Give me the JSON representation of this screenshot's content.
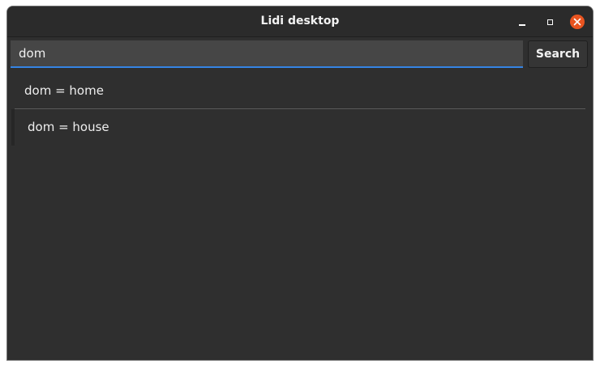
{
  "window": {
    "title": "Lidi desktop"
  },
  "controls": {
    "minimize": "minimize-icon",
    "maximize": "maximize-icon",
    "close": "close-icon",
    "close_color": "#e95420"
  },
  "search": {
    "value": "dom",
    "button_label": "Search",
    "focus_color": "#3584e4"
  },
  "results": [
    {
      "text": "dom = home"
    },
    {
      "text": "dom = house"
    }
  ]
}
